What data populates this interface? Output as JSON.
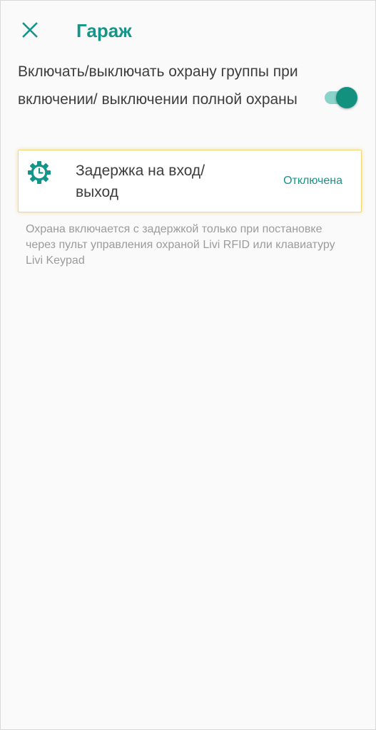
{
  "header": {
    "close_icon": "close-icon",
    "title": "Гараж"
  },
  "settings": {
    "group_guard_toggle": {
      "label": "Включать/выключать охрану группы при включении/ выключении полной охраны",
      "enabled": true
    },
    "entry_delay": {
      "icon": "gear-clock-icon",
      "label": "Задержка на вход/ выход",
      "value": "Отключена"
    },
    "hint": "Охрана включается с задержкой только при постановке через пульт управления охраной Livi RFID или клавиатуру Livi Keypad"
  },
  "colors": {
    "accent": "#14958a",
    "switch_track": "#8ad3cb",
    "switch_thumb": "#12917f",
    "card_highlight": "#f6d777",
    "text_primary": "#3d3d3d",
    "text_secondary": "#9b9b9b",
    "background": "#fafafa"
  }
}
